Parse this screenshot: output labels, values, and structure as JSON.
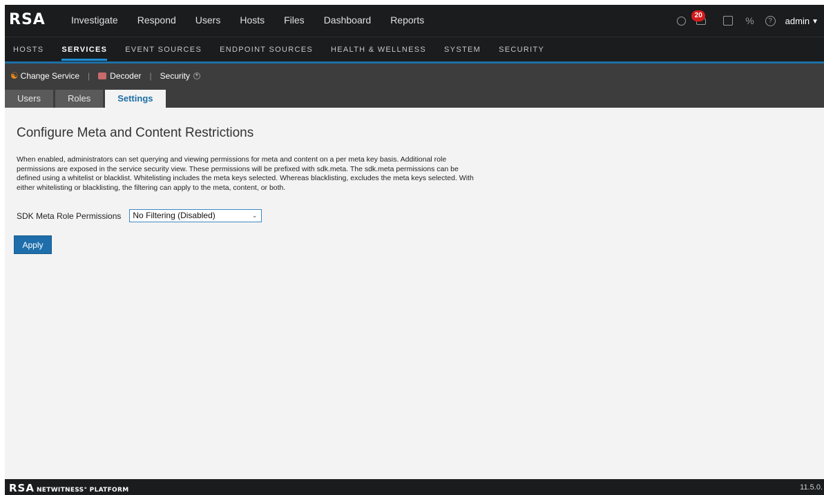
{
  "brand": {
    "logo": "RSA"
  },
  "main_nav": [
    "Investigate",
    "Respond",
    "Users",
    "Hosts",
    "Files",
    "Dashboard",
    "Reports"
  ],
  "top_right": {
    "notification_count": "20",
    "user": "admin",
    "icons": [
      "stopwatch-icon",
      "bell-icon",
      "tasks-icon",
      "tools-icon",
      "help-icon"
    ]
  },
  "sub_nav": {
    "items": [
      "HOSTS",
      "SERVICES",
      "EVENT SOURCES",
      "ENDPOINT SOURCES",
      "HEALTH & WELLNESS",
      "SYSTEM",
      "SECURITY"
    ],
    "active": "SERVICES"
  },
  "service_bar": {
    "change_service": "Change Service",
    "service_name": "Decoder",
    "view": "Security"
  },
  "tabs": [
    "Users",
    "Roles",
    "Settings"
  ],
  "active_tab": "Settings",
  "content": {
    "title": "Configure Meta and Content Restrictions",
    "description": "When enabled, administrators can set querying and viewing permissions for meta and content on a per meta key basis. Additional role permissions are exposed in the service security view. These permissions will be prefixed with sdk.meta. The sdk.meta permissions can be defined using a whitelist or blacklist. Whitelisting includes the meta keys selected. Whereas blacklisting, excludes the meta keys selected. With either whitelisting or blacklisting, the filtering can apply to the meta, content, or both.",
    "field_label": "SDK Meta Role Permissions",
    "field_value": "No Filtering (Disabled)",
    "apply_label": "Apply"
  },
  "footer": {
    "brand": "RSA",
    "product": "NETWITNESS° PLATFORM",
    "version": "11.5.0."
  },
  "colors": {
    "accent": "#1e6eab",
    "badge": "#d41c1c",
    "nav_bg": "#1a1c1e"
  }
}
